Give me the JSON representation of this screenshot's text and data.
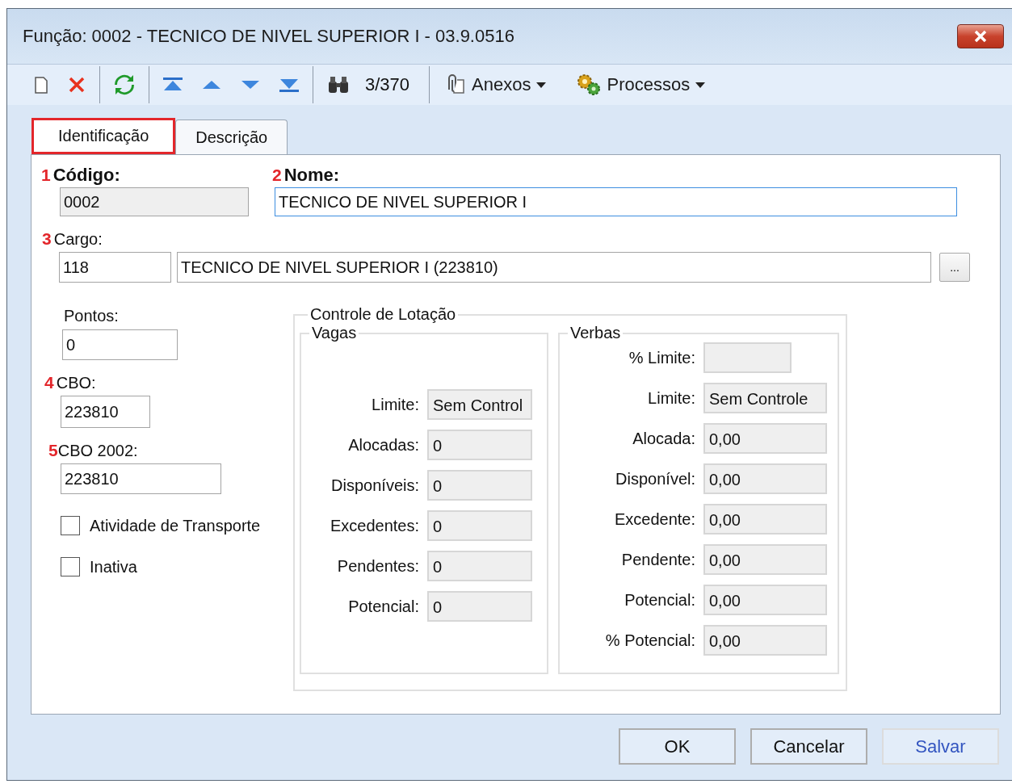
{
  "window": {
    "title": "Função: 0002 - TECNICO DE NIVEL SUPERIOR I - 03.9.0516"
  },
  "toolbar": {
    "record_counter": "3/370",
    "menus": [
      {
        "label": "Anexos",
        "kind": "attachments"
      },
      {
        "label": "Processos",
        "kind": "processes"
      }
    ]
  },
  "tabs": [
    {
      "label": "Identificação",
      "selected": true,
      "highlighted": true
    },
    {
      "label": "Descrição",
      "selected": false,
      "highlighted": false
    }
  ],
  "codigo": {
    "marker": "1",
    "label": "Código:",
    "value": "0002"
  },
  "nome": {
    "marker": "2",
    "label": "Nome:",
    "value": "TECNICO DE NIVEL SUPERIOR I"
  },
  "cargo": {
    "marker": "3",
    "label": "Cargo:",
    "code": "118",
    "description": "TECNICO DE NIVEL SUPERIOR I (223810)",
    "lookup_button": "..."
  },
  "pontos": {
    "label": "Pontos:",
    "value": "0"
  },
  "cbo": {
    "marker": "4",
    "label": "CBO:",
    "value": "223810"
  },
  "cbo_2002": {
    "marker": "5",
    "label": "CBO 2002:",
    "value": "223810"
  },
  "checkboxes": [
    {
      "label": "Atividade de Transporte",
      "checked": false
    },
    {
      "label": "Inativa",
      "checked": false
    }
  ],
  "controle_de_lotacao": {
    "title": "Controle de Lotação",
    "vagas": {
      "title": "Vagas",
      "fields": [
        {
          "label": "Limite:",
          "value": "Sem Control"
        },
        {
          "label": "Alocadas:",
          "value": "0"
        },
        {
          "label": "Disponíveis:",
          "value": "0"
        },
        {
          "label": "Excedentes:",
          "value": "0"
        },
        {
          "label": "Pendentes:",
          "value": "0"
        },
        {
          "label": "Potencial:",
          "value": "0"
        }
      ]
    },
    "verbas": {
      "title": "Verbas",
      "fields": [
        {
          "label": "% Limite:"
        },
        {
          "label": "Limite:",
          "value": "Sem Controle"
        },
        {
          "label": "Alocada:",
          "value": "0,00"
        },
        {
          "label": "Disponível:",
          "value": "0,00"
        },
        {
          "label": "Excedente:",
          "value": "0,00"
        },
        {
          "label": "Pendente:",
          "value": "0,00"
        },
        {
          "label": "Potencial:",
          "value": "0,00"
        },
        {
          "label": "% Potencial:",
          "value": "0,00"
        }
      ]
    }
  },
  "buttons": [
    {
      "label": "OK",
      "disabled": false
    },
    {
      "label": "Cancelar",
      "disabled": false
    },
    {
      "label": "Salvar",
      "disabled": true
    }
  ]
}
